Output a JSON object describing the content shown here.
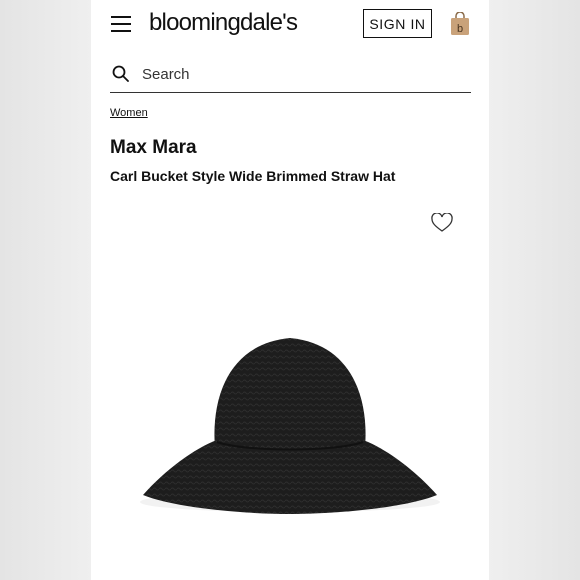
{
  "header": {
    "logo_text": "bloomingdale's",
    "signin_label": "SIGN IN",
    "menu_icon": "hamburger-menu-icon",
    "bag_icon": "shopping-bag-icon"
  },
  "search": {
    "placeholder": "Search",
    "value": ""
  },
  "product": {
    "breadcrumb": "Women",
    "brand": "Max Mara",
    "name": "Carl Bucket Style Wide Brimmed Straw Hat",
    "wishlist_icon": "heart-icon"
  },
  "colors": {
    "bag_accent": "#c9a27a",
    "text": "#111111",
    "background": "#ffffff"
  }
}
